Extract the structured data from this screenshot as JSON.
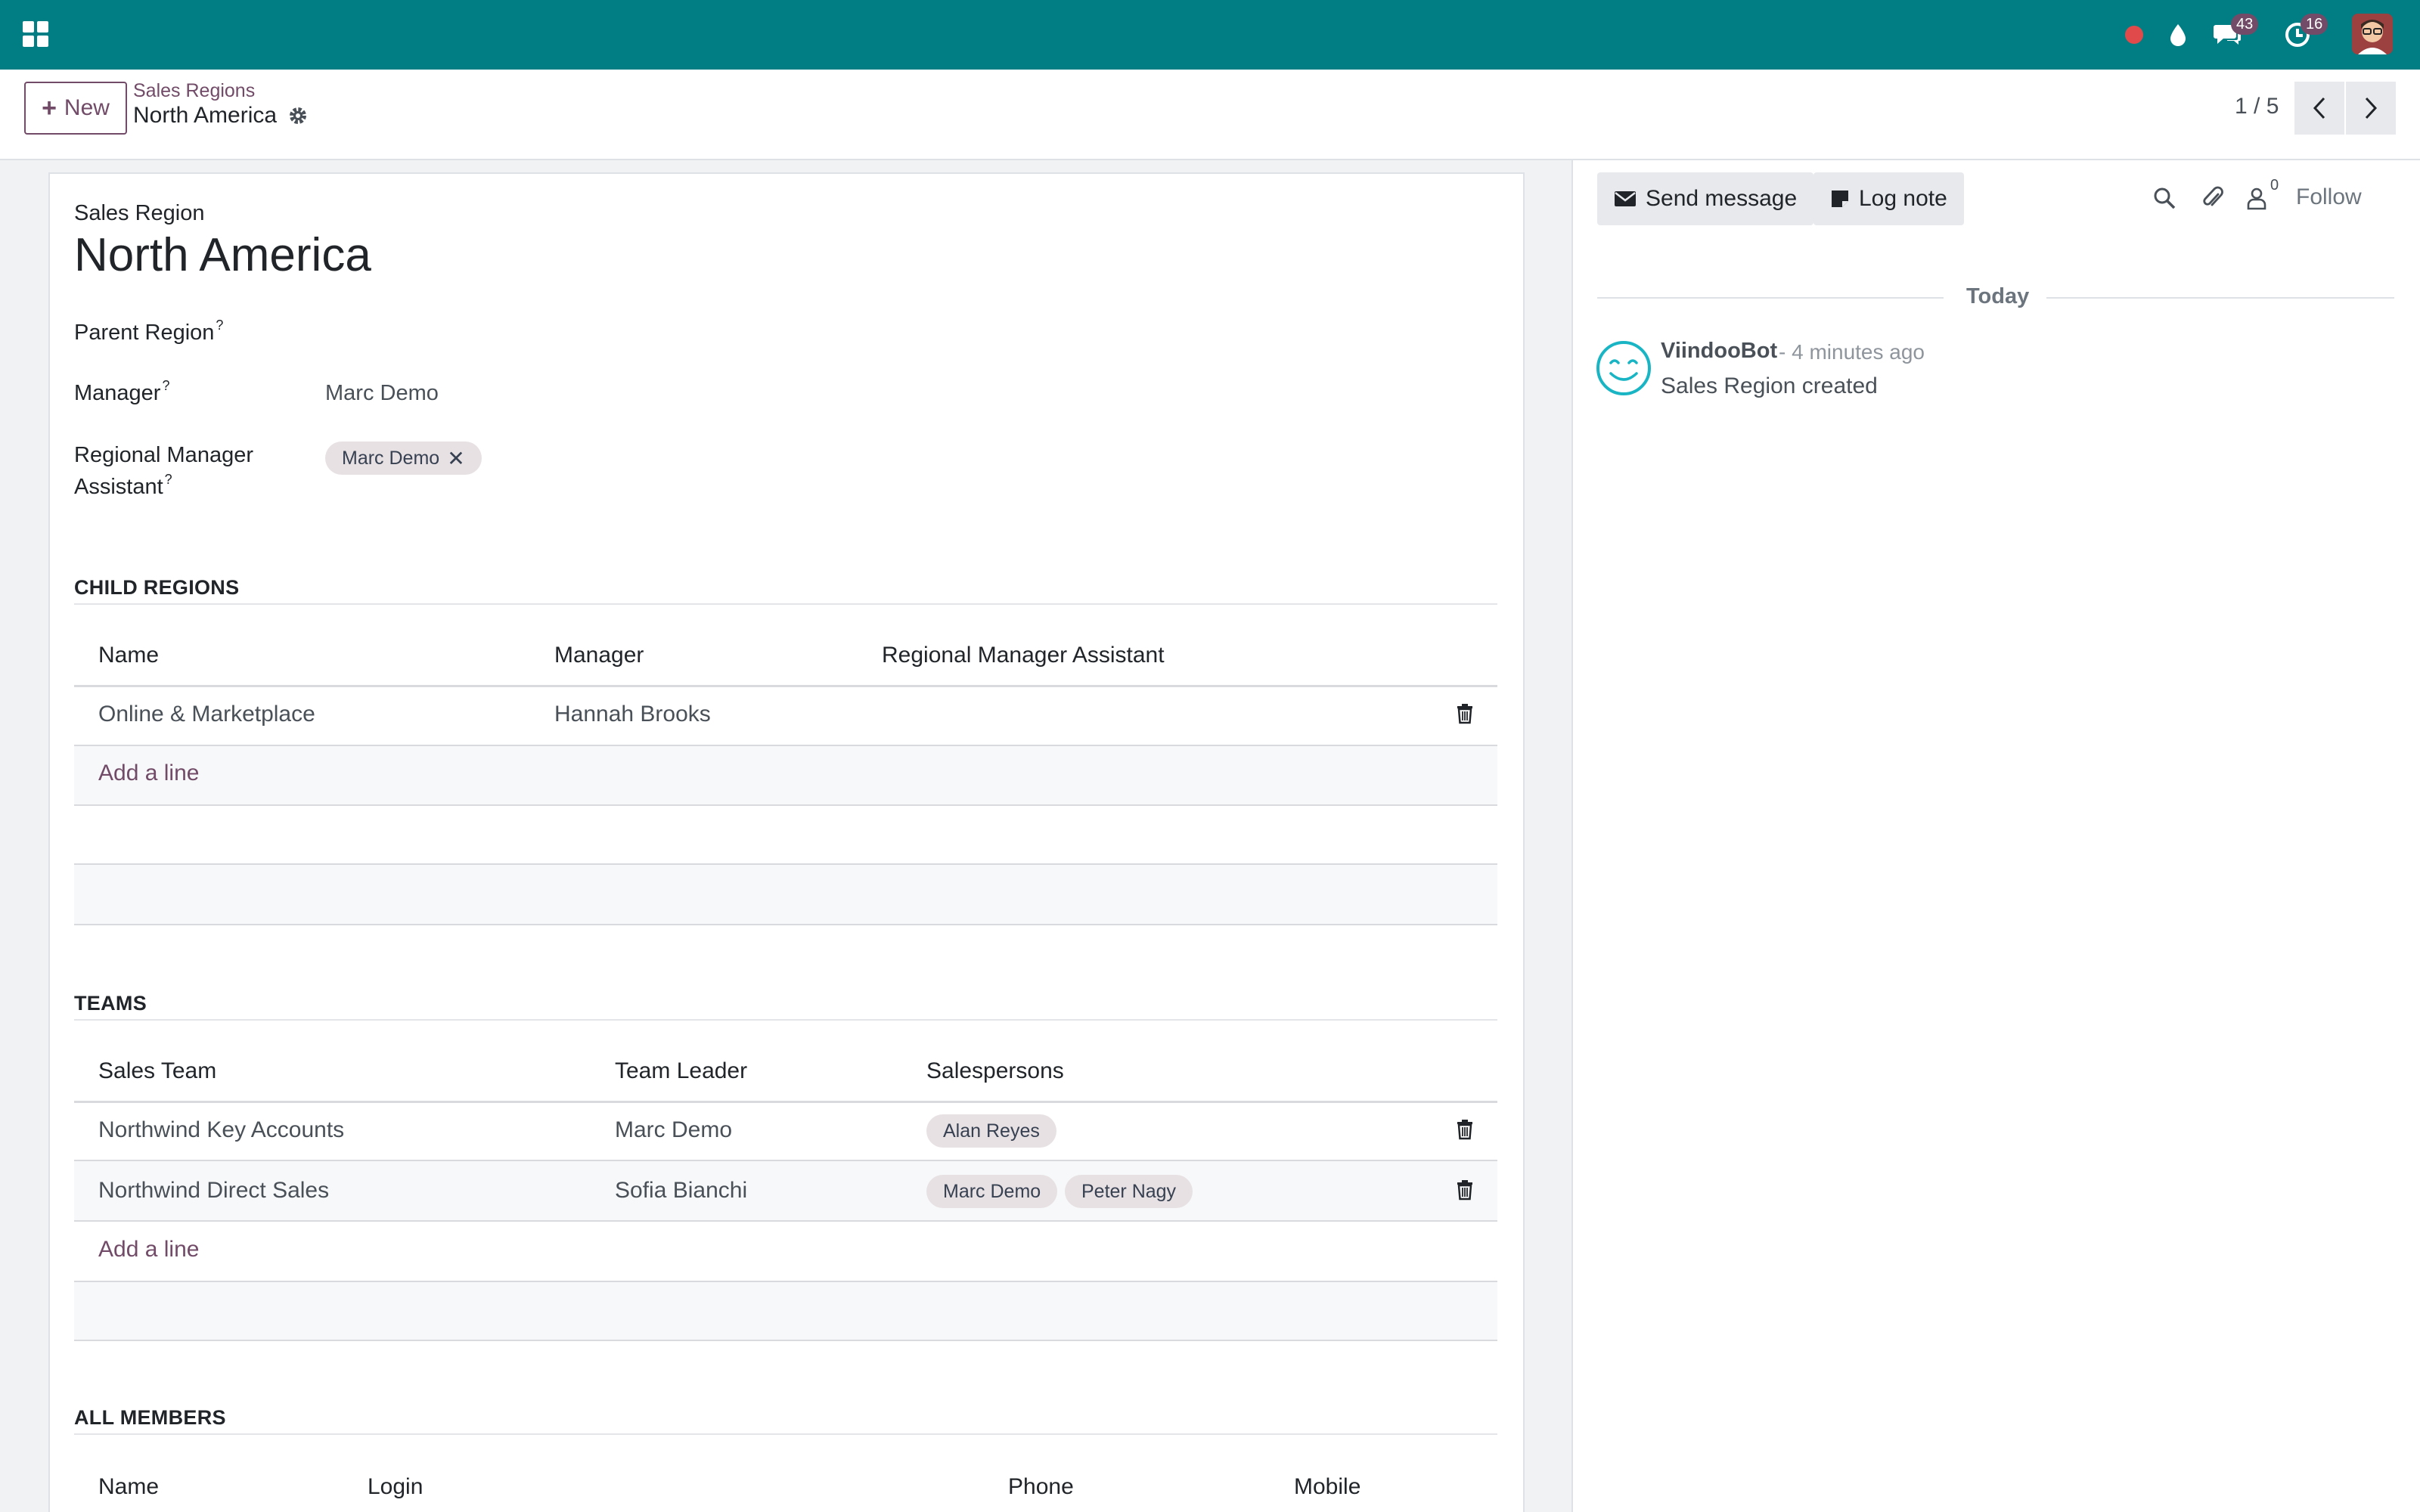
{
  "navbar": {
    "badges": {
      "messages": "43",
      "activities": "16"
    }
  },
  "control": {
    "new_label": "New",
    "breadcrumb": "Sales Regions",
    "record": "North America",
    "pager": "1 / 5"
  },
  "form": {
    "label_top": "Sales Region",
    "title": "North America",
    "parent_region_label": "Parent Region",
    "manager_label": "Manager",
    "manager_value": "Marc Demo",
    "rma_label_1": "Regional Manager",
    "rma_label_2": "Assistant",
    "rma_tag": "Marc Demo",
    "help_mark": "?"
  },
  "child_regions": {
    "title": "CHILD REGIONS",
    "headers": [
      "Name",
      "Manager",
      "Regional Manager Assistant"
    ],
    "rows": [
      {
        "name": "Online & Marketplace",
        "manager": "Hannah Brooks",
        "assistant": ""
      }
    ],
    "add_line": "Add a line"
  },
  "teams": {
    "title": "TEAMS",
    "headers": [
      "Sales Team",
      "Team Leader",
      "Salespersons"
    ],
    "rows": [
      {
        "team": "Northwind Key Accounts",
        "leader": "Marc Demo",
        "salespersons": [
          "Alan Reyes"
        ]
      },
      {
        "team": "Northwind Direct Sales",
        "leader": "Sofia Bianchi",
        "salespersons": [
          "Marc Demo",
          "Peter Nagy"
        ]
      }
    ],
    "add_line": "Add a line"
  },
  "all_members": {
    "title": "ALL MEMBERS",
    "headers": [
      "Name",
      "Login",
      "Phone",
      "Mobile"
    ]
  },
  "chatter": {
    "send_message": "Send message",
    "log_note": "Log note",
    "followers_count": "0",
    "follow": "Follow",
    "date_separator": "Today",
    "messages": [
      {
        "author": "ViindooBot",
        "time": "- 4 minutes ago",
        "body": "Sales Region created"
      }
    ]
  },
  "colors": {
    "navbar": "#017e84",
    "accent": "#714b67",
    "record_indicator": "#e04a4a"
  }
}
